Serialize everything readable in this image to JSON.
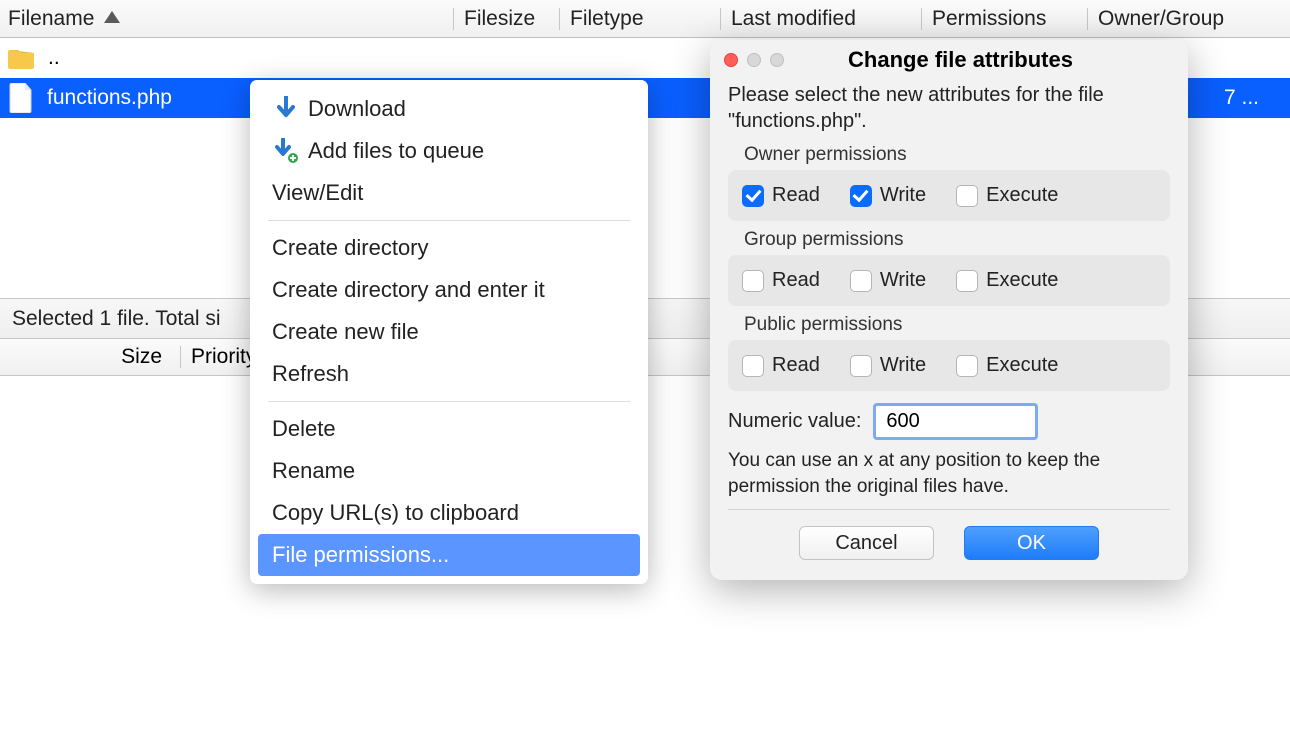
{
  "columns": {
    "filename": "Filename",
    "filesize": "Filesize",
    "filetype": "Filetype",
    "lastmod": "Last modified",
    "permissions": "Permissions",
    "ownergrp": "Owner/Group"
  },
  "rows": {
    "parent": "..",
    "file": "functions.php",
    "owner_trunc": "7 ..."
  },
  "status": "Selected 1 file. Total si",
  "lower": {
    "size": "Size",
    "priority": "Priority"
  },
  "menu": {
    "download": "Download",
    "addqueue": "Add files to queue",
    "viewedit": "View/Edit",
    "createdir": "Create directory",
    "createdir_enter": "Create directory and enter it",
    "createfile": "Create new file",
    "refresh": "Refresh",
    "delete": "Delete",
    "rename": "Rename",
    "copyurl": "Copy URL(s) to clipboard",
    "fileperm": "File permissions..."
  },
  "dialog": {
    "title": "Change file attributes",
    "lead": "Please select the new attributes for the file \"functions.php\".",
    "owner_label": "Owner permissions",
    "group_label": "Group permissions",
    "public_label": "Public permissions",
    "read": "Read",
    "write": "Write",
    "execute": "Execute",
    "numeric_label": "Numeric value:",
    "numeric_value": "600",
    "note": "You can use an x at any position to keep the permission the original files have.",
    "cancel": "Cancel",
    "ok": "OK",
    "owner": {
      "read": true,
      "write": true,
      "execute": false
    },
    "group": {
      "read": false,
      "write": false,
      "execute": false
    },
    "public": {
      "read": false,
      "write": false,
      "execute": false
    }
  }
}
